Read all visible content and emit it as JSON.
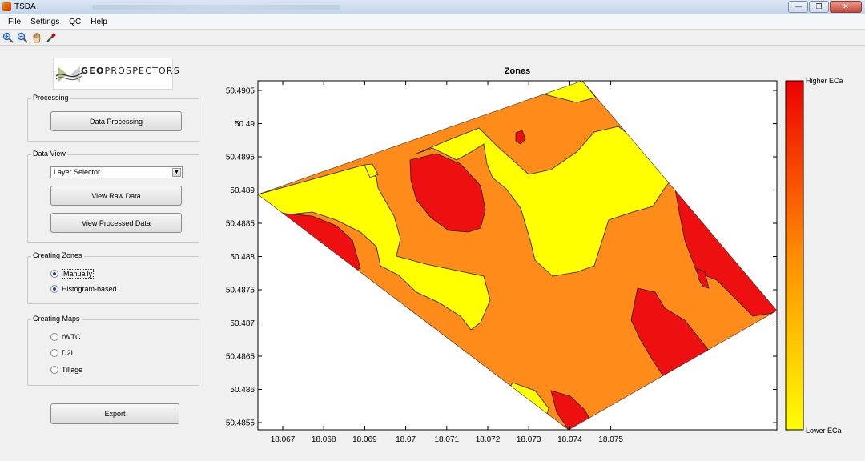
{
  "window": {
    "title": "TSDA",
    "buttons": {
      "minimize": "—",
      "restore": "❐",
      "close": "✕"
    }
  },
  "menu": [
    "File",
    "Settings",
    "QC",
    "Help"
  ],
  "toolbar": [
    {
      "name": "zoom-in-icon",
      "color": "#2a62c8"
    },
    {
      "name": "zoom-out-icon",
      "color": "#2a62c8"
    },
    {
      "name": "pan-hand-icon",
      "color": "#b87a2a"
    },
    {
      "name": "data-cursor-icon",
      "color": "#444444"
    }
  ],
  "logo": {
    "text_bold": "GEO",
    "text_rest": "PROSPECTORS"
  },
  "processing": {
    "label": "Processing",
    "button": "Data Processing"
  },
  "data_view": {
    "label": "Data View",
    "selector": "Layer Selector",
    "raw_button": "View Raw Data",
    "processed_button": "View Processed Data"
  },
  "creating_zones": {
    "label": "Creating Zones",
    "options": [
      {
        "label": "Manually",
        "selected": true
      },
      {
        "label": "Histogram-based",
        "selected": true
      }
    ]
  },
  "creating_maps": {
    "label": "Creating Maps",
    "options": [
      {
        "label": "rWTC",
        "selected": false
      },
      {
        "label": "D2I",
        "selected": false
      },
      {
        "label": "Tillage",
        "selected": false
      }
    ]
  },
  "export_button": "Export",
  "plot": {
    "title": "Zones",
    "xticks": [
      "18.067",
      "18.068",
      "18.069",
      "18.07",
      "18.071",
      "18.072",
      "18.073",
      "18.074",
      "18.075"
    ],
    "yticks": [
      "50.4905",
      "50.49",
      "50.4895",
      "50.489",
      "50.4885",
      "50.488",
      "50.4875",
      "50.487",
      "50.4865",
      "50.486",
      "50.4855"
    ],
    "colors": {
      "low": "#ffff00",
      "mid": "#ff8c1a",
      "high": "#ee1010"
    }
  },
  "colorbar": {
    "top_label": "Higher ECa",
    "bottom_label": "Lower ECa"
  }
}
